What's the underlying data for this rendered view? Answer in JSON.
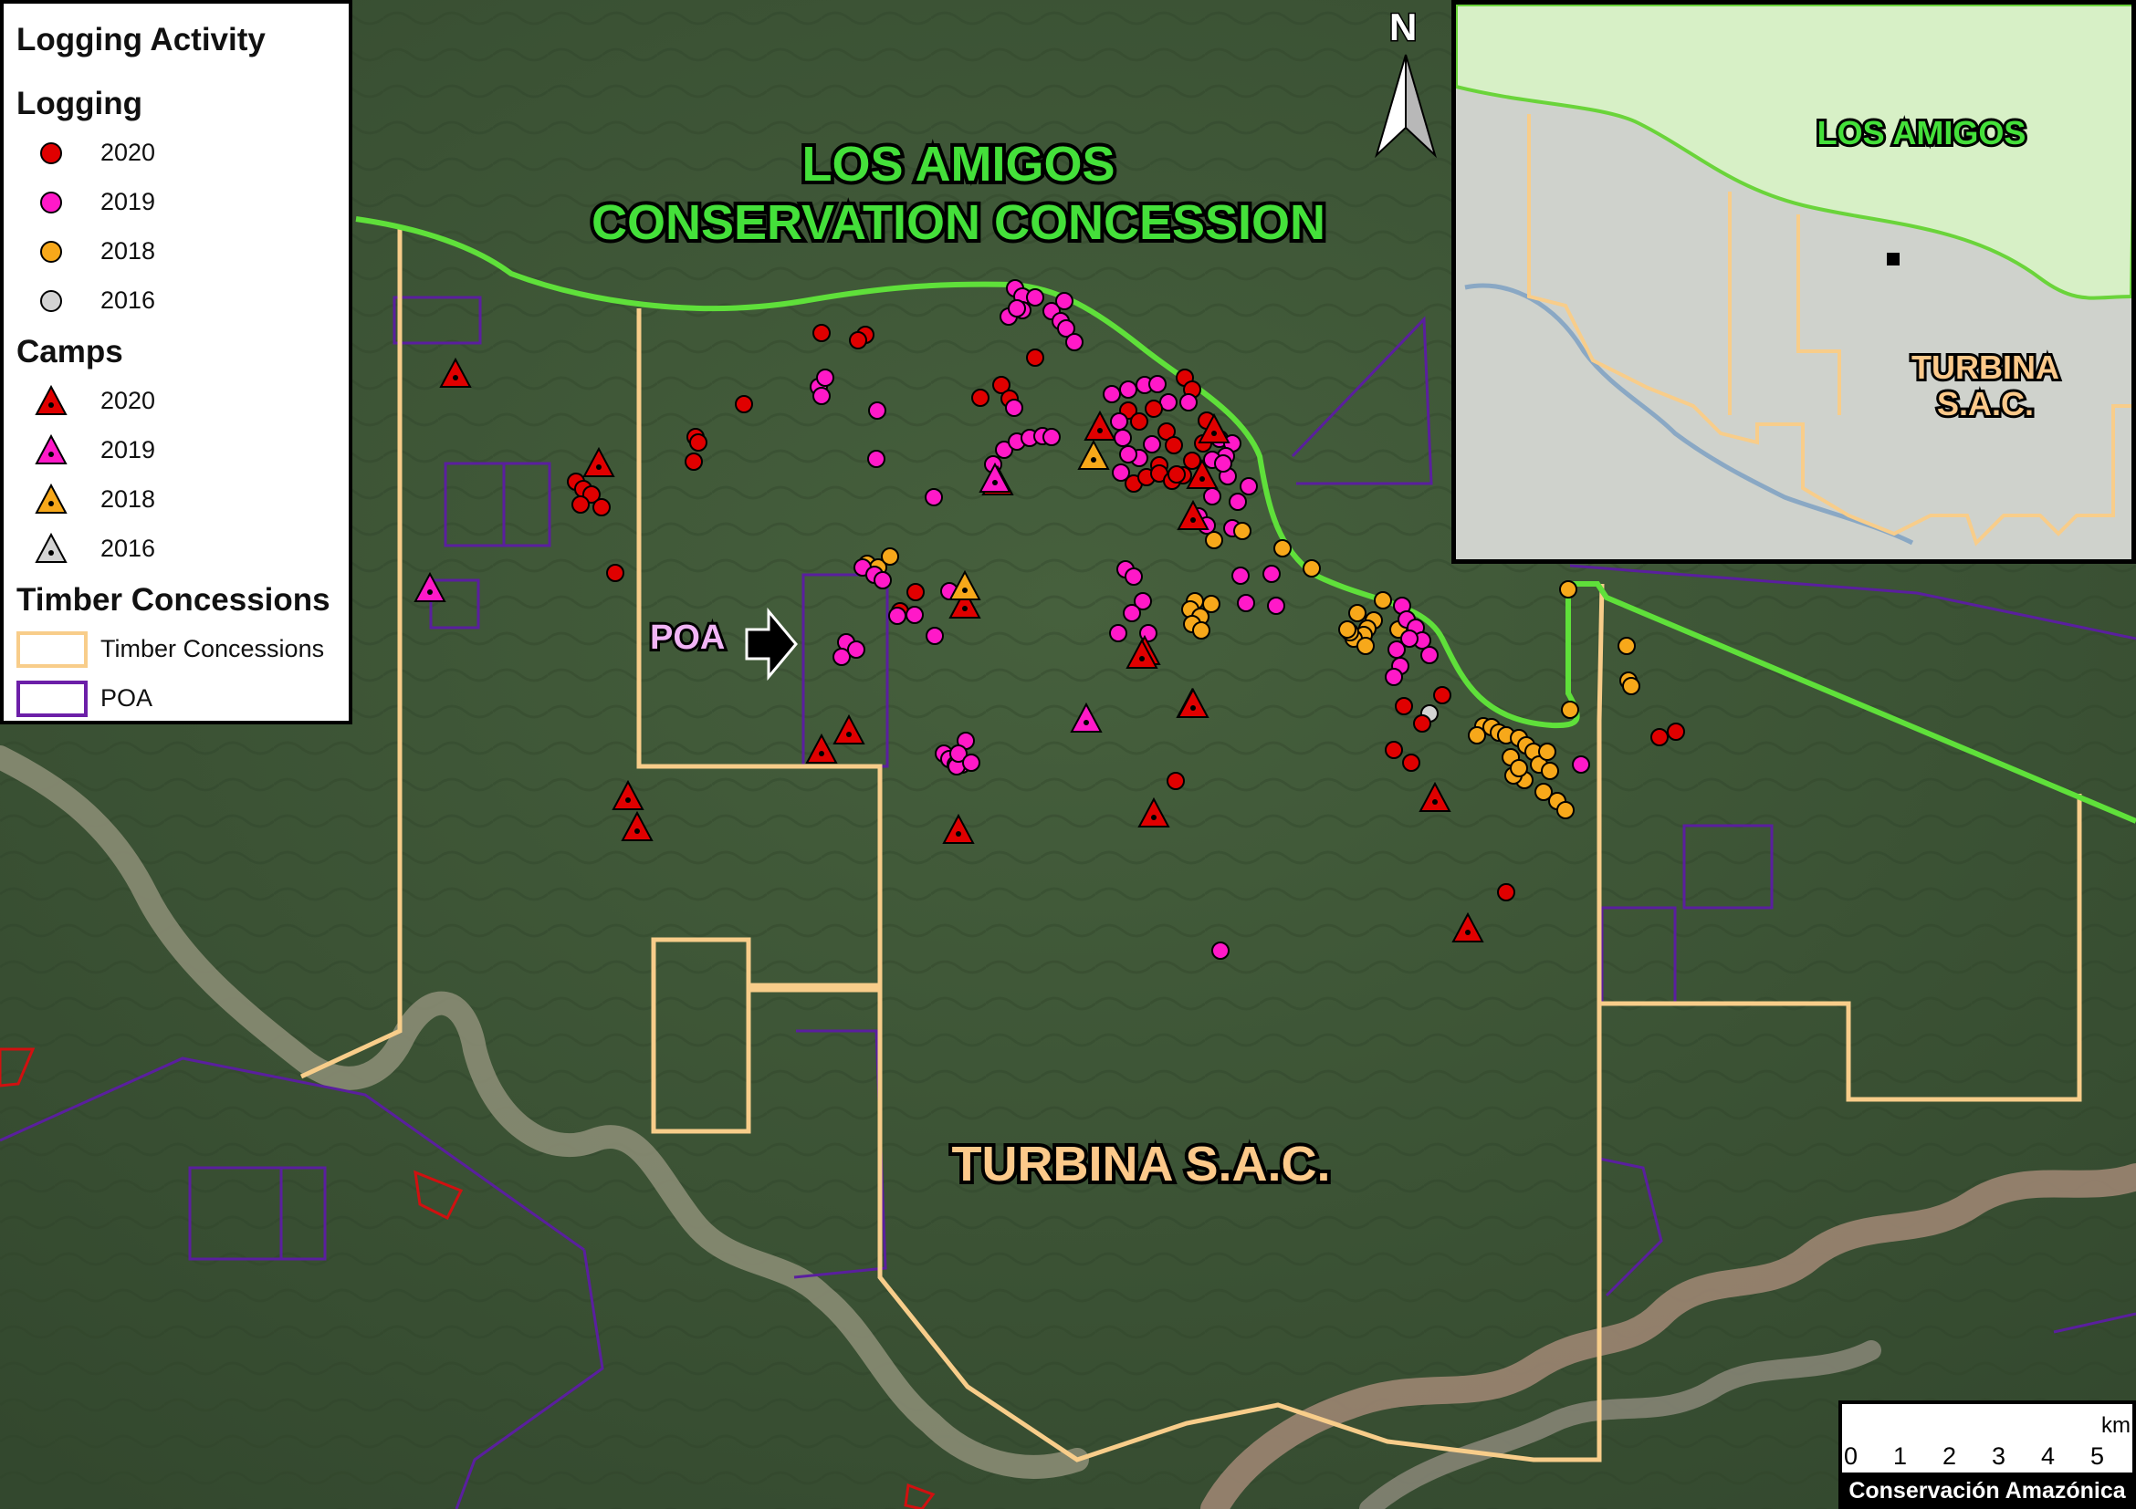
{
  "legend": {
    "title": "Logging Activity",
    "logging_heading": "Logging",
    "logging_items": [
      {
        "label": "2020",
        "color": "#e00000"
      },
      {
        "label": "2019",
        "color": "#ff19c8"
      },
      {
        "label": "2018",
        "color": "#f7a81a"
      },
      {
        "label": "2016",
        "color": "#d3d3d3"
      }
    ],
    "camps_heading": "Camps",
    "camps_items": [
      {
        "label": "2020",
        "color": "#e00000"
      },
      {
        "label": "2019",
        "color": "#ff19c8"
      },
      {
        "label": "2018",
        "color": "#f7a81a"
      },
      {
        "label": "2016",
        "color": "#d3d3d3"
      }
    ],
    "timber_heading": "Timber Concessions",
    "timber_items": [
      {
        "label": "Timber Concessions",
        "color": "#f8cd8a"
      },
      {
        "label": "POA",
        "color": "#6c1fa8"
      }
    ]
  },
  "labels": {
    "los_amigos_line1": "LOS AMIGOS",
    "los_amigos_line2": "CONSERVATION CONCESSION",
    "turbina": "TURBINA S.A.C.",
    "poa": "POA",
    "north": "N"
  },
  "inset": {
    "los_amigos": "LOS AMIGOS",
    "turbina_line1": "TURBINA",
    "turbina_line2": "S.A.C."
  },
  "scale": {
    "ticks": [
      "0",
      "1",
      "2",
      "3",
      "4",
      "5"
    ],
    "unit": "km",
    "credit": "Conservación Amazónica"
  },
  "colors": {
    "conservation_boundary": "#5fe03a",
    "timber_boundary": "#f8cd8a",
    "poa_boundary": "#5a1f9e",
    "forest": "#3d5636"
  }
}
